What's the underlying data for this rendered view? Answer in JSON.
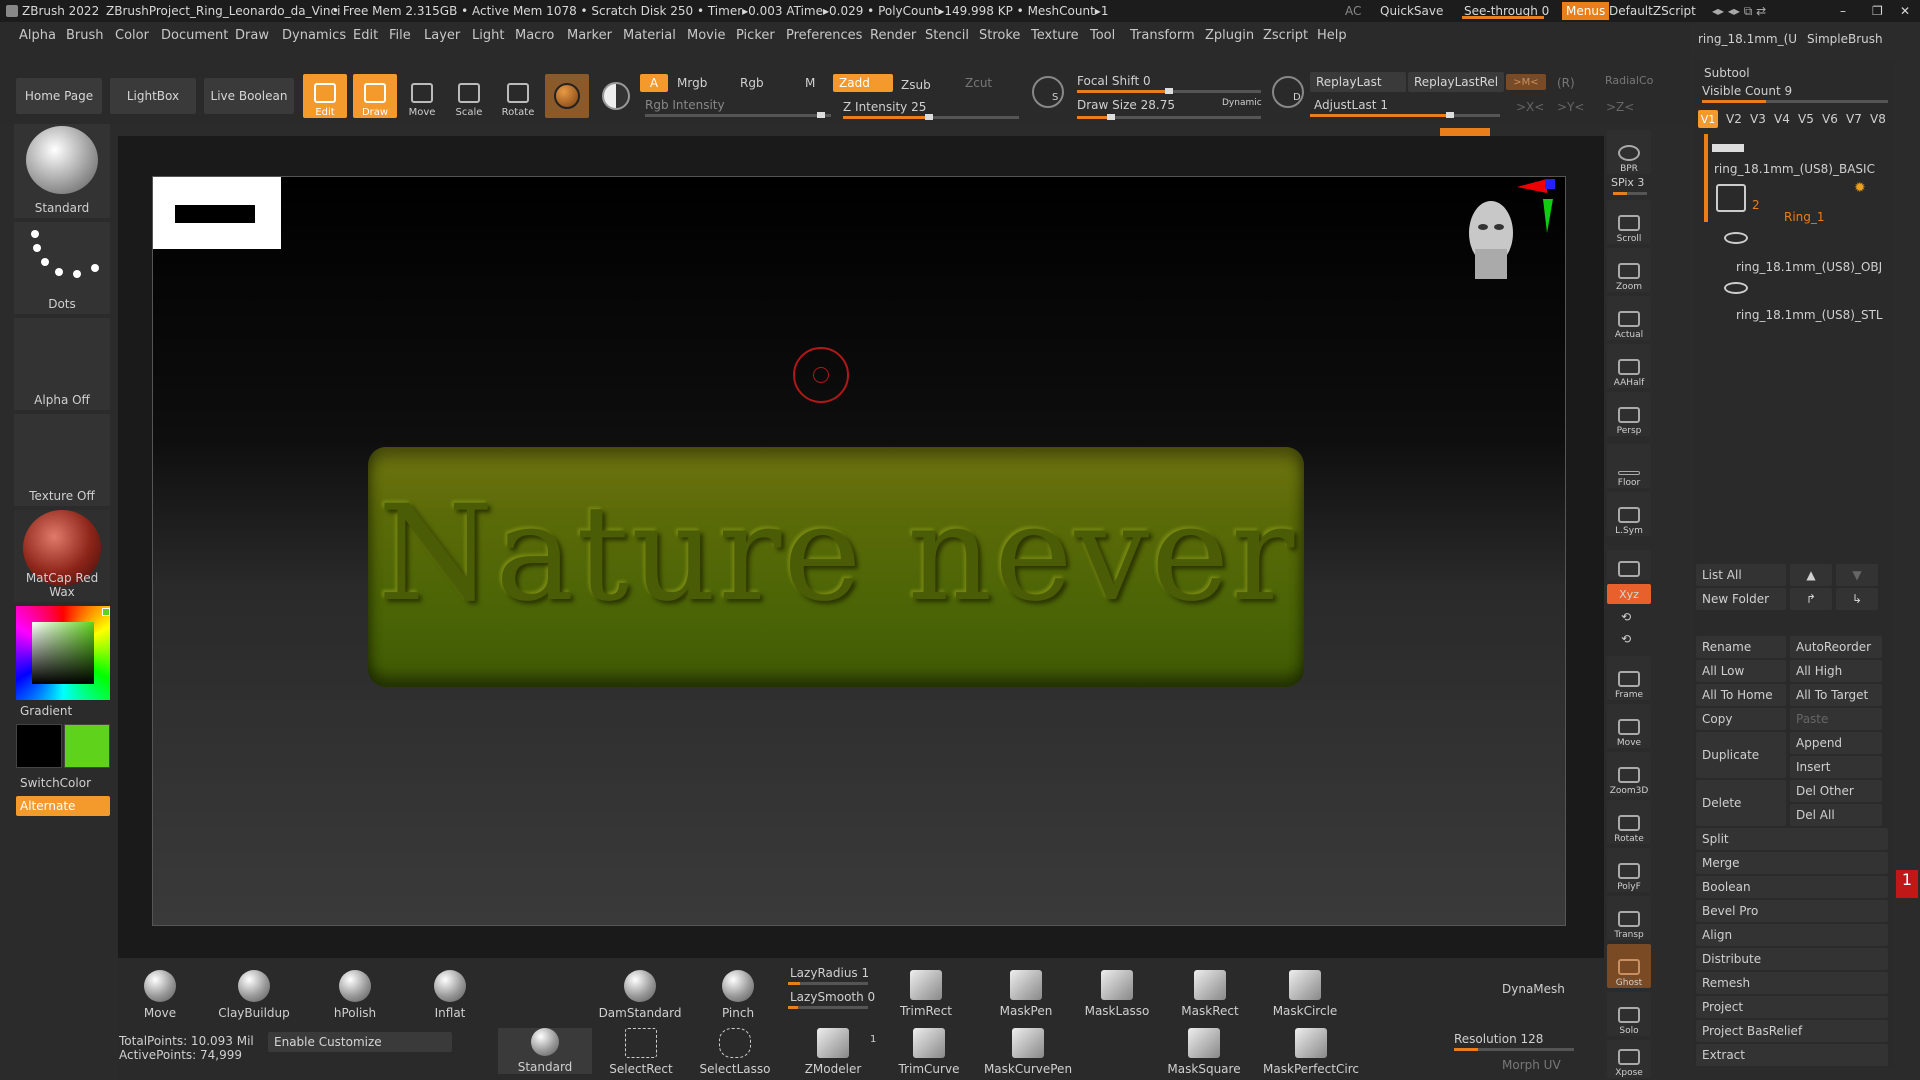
{
  "titlebar": {
    "app": "ZBrush 2022",
    "project": "ZBrushProject_Ring_Leonardo_da_Vinci",
    "stats": "• Free Mem 2.315GB • Active Mem 1078 • Scratch Disk 250 •  Timer▸0.003 ATime▸0.029 • PolyCount▸149.998 KP  • MeshCount▸1",
    "ac": "AC",
    "quicksave": "QuickSave",
    "seethrough": "See-through  0",
    "menus": "Menus",
    "zscript": "DefaultZScript"
  },
  "menu": [
    "Alpha",
    "Brush",
    "Color",
    "Document",
    "Draw",
    "Dynamics",
    "Edit",
    "File",
    "Layer",
    "Light",
    "Macro",
    "Marker",
    "Material",
    "Movie",
    "Picker",
    "Preferences",
    "Render",
    "Stencil",
    "Stroke",
    "Texture",
    "Tool",
    "Transform",
    "Zplugin",
    "Zscript",
    "Help"
  ],
  "shelf": {
    "home": "Home Page",
    "lightbox": "LightBox",
    "liveboolean": "Live Boolean",
    "tools": [
      "Edit",
      "Draw",
      "Move",
      "Scale",
      "Rotate"
    ],
    "a": "A",
    "mrgb": "Mrgb",
    "rgb": "Rgb",
    "m": "M",
    "zadd": "Zadd",
    "zsub": "Zsub",
    "zcut": "Zcut",
    "rgb_intensity": "Rgb Intensity",
    "z_intensity": "Z Intensity 25",
    "focal_shift": "Focal Shift 0",
    "draw_size": "Draw Size 28.75",
    "dynamic": "Dynamic",
    "replaylast": "ReplayLast",
    "replaylastrel": "ReplayLastRel",
    "adjustlast": "AdjustLast 1",
    "radialco": "RadialCo",
    "xsym": ">X<",
    "ysym": ">Y<",
    "zsym": ">Z<",
    "mbtn": ">M<",
    "r": "(R)",
    "s_label": "S",
    "d_label": "D"
  },
  "left": {
    "brush": "Standard",
    "stroke": "Dots",
    "alpha": "Alpha Off",
    "texture": "Texture Off",
    "material": "MatCap Red Wax",
    "gradient": "Gradient",
    "switchcolor": "SwitchColor",
    "alternate": "Alternate",
    "colors": {
      "main": "#000000",
      "secondary": "#5fd21c"
    }
  },
  "viewport": {
    "ring_text": "Nature  never  br"
  },
  "righttools": [
    {
      "label": "BPR",
      "icon": "bpr-icon"
    },
    {
      "label": "SPix 3",
      "icon": ""
    },
    {
      "label": "Scroll",
      "icon": "scroll-icon"
    },
    {
      "label": "Zoom",
      "icon": "zoom-icon"
    },
    {
      "label": "Actual",
      "icon": "actual-icon"
    },
    {
      "label": "AAHalf",
      "icon": "aahalf-icon"
    },
    {
      "label": "Persp",
      "icon": "persp-icon"
    },
    {
      "label": "Floor",
      "icon": "floor-icon"
    },
    {
      "label": "L.Sym",
      "icon": "lsym-icon"
    },
    {
      "label": "Xyz",
      "icon": "xyz-icon"
    },
    {
      "label": "Frame",
      "icon": "frame-icon"
    },
    {
      "label": "Move",
      "icon": "move-icon"
    },
    {
      "label": "Zoom3D",
      "icon": "zoom3d-icon"
    },
    {
      "label": "Rotate",
      "icon": "rotate-icon"
    },
    {
      "label": "PolyF",
      "icon": "polyf-icon"
    },
    {
      "label": "Transp",
      "icon": "transp-icon"
    },
    {
      "label": "Ghost",
      "icon": "ghost-icon"
    },
    {
      "label": "Solo",
      "icon": "solo-icon"
    },
    {
      "label": "Xpose",
      "icon": "xpose-icon"
    }
  ],
  "subtool": {
    "top_left": "ring_18.1mm_(U",
    "top_right": "SimpleBrush",
    "title": "Subtool",
    "visible_count": "Visible Count 9",
    "vtabs": [
      "V1",
      "V2",
      "V3",
      "V4",
      "V5",
      "V6",
      "V7",
      "V8"
    ],
    "items": [
      {
        "name": "ring_18.1mm_(US8)_BASIC"
      },
      {
        "name": "Ring_1",
        "count": "2"
      },
      {
        "name": "ring_18.1mm_(US8)_OBJ"
      },
      {
        "name": "ring_18.1mm_(US8)_STL"
      }
    ],
    "list_all": "List All",
    "new_folder": "New Folder",
    "buttons": {
      "rename": "Rename",
      "autoreorder": "AutoReorder",
      "alllow": "All Low",
      "allhigh": "All High",
      "alltohome": "All To Home",
      "alltotarget": "All To Target",
      "copy": "Copy",
      "paste": "Paste",
      "duplicate": "Duplicate",
      "append": "Append",
      "insert": "Insert",
      "delete": "Delete",
      "delother": "Del Other",
      "delall": "Del All"
    },
    "sections": [
      "Split",
      "Merge",
      "Boolean",
      "Bevel Pro",
      "Align",
      "Distribute",
      "Remesh",
      "Project",
      "Project BasRelief",
      "Extract"
    ]
  },
  "bottom": {
    "brushes1": [
      "Move",
      "ClayBuildup",
      "hPolish",
      "Inflat",
      "DamStandard",
      "Pinch"
    ],
    "lazyradius": "LazyRadius 1",
    "lazysmooth": "LazySmooth 0",
    "brushes2": [
      "TrimRect",
      "MaskPen",
      "MaskLasso",
      "MaskRect",
      "MaskCircle"
    ],
    "dynamesh": "DynaMesh",
    "totalpoints": "TotalPoints: 10.093 Mil",
    "activepoints": "ActivePoints: 74,999",
    "enable_customize": "Enable Customize",
    "brushes3": [
      "Standard",
      "SelectRect",
      "SelectLasso",
      "ZModeler",
      "TrimCurve",
      "MaskCurvePen",
      "MaskSquare",
      "MaskPerfectCirc"
    ],
    "zmodeler_num": "1",
    "resolution": "Resolution 128",
    "morph": "Morph UV"
  }
}
